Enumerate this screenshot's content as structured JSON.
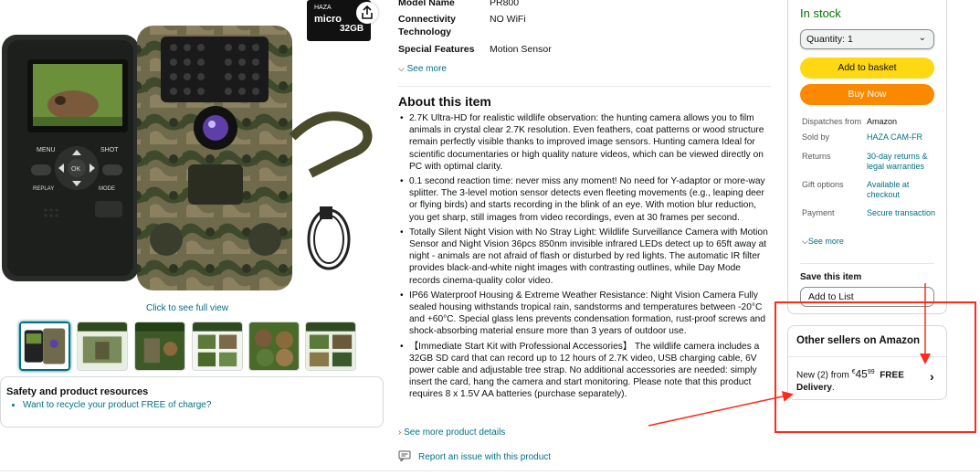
{
  "gallery": {
    "micro_sd_label": "32GB",
    "micro_sd_brand": "HAZA",
    "micro_sd_type": "micro",
    "camera_buttons": [
      "MENU",
      "SHOT",
      "OK",
      "REPLAY",
      "MODE"
    ],
    "click_to_see": "Click to see full view"
  },
  "specs": {
    "model_name_label": "Model Name",
    "model_name_value": "PR800",
    "connectivity_label": "Connectivity Technology",
    "connectivity_value": "NO WiFi",
    "features_label": "Special Features",
    "features_value": "Motion Sensor",
    "see_more": "See more"
  },
  "about": {
    "title": "About this item",
    "bullets": [
      "2.7K Ultra-HD for realistic wildlife observation: the hunting camera allows you to film animals in crystal clear 2.7K resolution. Even feathers, coat patterns or wood structure remain perfectly visible thanks to improved image sensors. Hunting camera Ideal for scientific documentaries or high quality nature videos, which can be viewed directly on PC with optimal clarity.",
      "0.1 second reaction time: never miss any moment! No need for Y-adaptor or more-way splitter. The 3-level motion sensor detects even fleeting movements (e.g., leaping deer or flying birds) and starts recording in the blink of an eye. With motion blur reduction, you get sharp, still images from video recordings, even at 30 frames per second.",
      "Totally Silent Night Vision with No Stray Light: Wildlife Surveillance Camera with Motion Sensor and Night Vision 36pcs 850nm invisible infrared LEDs detect up to 65ft away at night - animals are not afraid of flash or disturbed by red lights. The automatic IR filter provides black-and-white night images with contrasting outlines, while Day Mode records cinema-quality color video.",
      "IP66 Waterproof Housing & Extreme Weather Resistance: Night Vision Camera Fully sealed housing withstands tropical rain, sandstorms and temperatures between -20°C and +60°C. Special glass lens prevents condensation formation, rust-proof screws and shock-absorbing material ensure more than 3 years of outdoor use.",
      "【Immediate Start Kit with Professional Accessories】 The wildlife camera includes a 32GB SD card that can record up to 12 hours of 2.7K video, USB charging cable, 6V power cable and adjustable tree strap. No additional accessories are needed: simply insert the card, hang the camera and start monitoring. Please note that this product requires 8 x 1.5V AA batteries (purchase separately)."
    ],
    "see_more_details": "See more product details",
    "report_issue": "Report an issue with this product"
  },
  "safety": {
    "title": "Safety and product resources",
    "link": "Want to recycle your product FREE of charge?"
  },
  "buybox": {
    "stock": "In stock",
    "quantity": "Quantity: 1",
    "add_to_basket": "Add to basket",
    "buy_now": "Buy Now",
    "rows": [
      {
        "k": "Dispatches from",
        "v": "Amazon"
      },
      {
        "k": "Sold by",
        "v": "HAZA CAM-FR"
      },
      {
        "k": "Returns",
        "v": "30-day returns & legal warranties"
      },
      {
        "k": "Gift options",
        "v": "Available at checkout"
      },
      {
        "k": "Payment",
        "v": "Secure transaction"
      }
    ],
    "see_more": "See more",
    "save_title": "Save this item",
    "add_to_list": "Add to List"
  },
  "other_sellers": {
    "title": "Other sellers on Amazon",
    "prefix": "New (2) from ",
    "currency": "€",
    "price_whole": "45",
    "price_fraction": "99",
    "free": "FREE",
    "delivery": "Delivery",
    "delivery_suffix": "."
  },
  "colors": {
    "link": "#007185",
    "stock": "#007600",
    "add_to_basket": "#ffd814",
    "buy_now": "#fa8900",
    "annotation": "#ff2a1a"
  }
}
